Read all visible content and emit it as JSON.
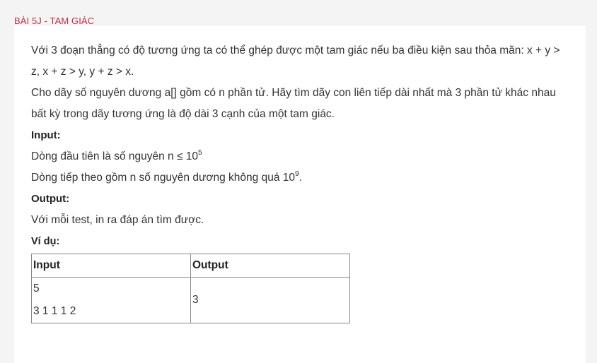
{
  "header": {
    "title": "BÀI 5J - TAM GIÁC"
  },
  "problem": {
    "paragraph1": "Với 3 đoạn thẳng có độ tương ứng ta có thể ghép được một tam giác nếu ba điều kiện sau thỏa mãn: x + y > z, x + z > y, y + z > x.",
    "paragraph2": "Cho dãy số nguyên dương a[] gồm có n phần tử. Hãy tìm dãy con liên tiếp dài nhất mà 3 phần tử khác nhau bất kỳ trong dãy tương ứng là độ dài 3 cạnh của một tam giác.",
    "input_heading": "Input:",
    "input_line1_text": "Dòng đầu tiên là số nguyên n ≤ 10",
    "input_line1_exp": "5",
    "input_line2_text": "Dòng tiếp theo gồm n số nguyên dương không quá 10",
    "input_line2_exp": "9",
    "input_line2_suffix": ".",
    "output_heading": "Output:",
    "output_text": "Với mỗi test, in ra đáp án tìm được.",
    "example_heading": "Ví dụ:"
  },
  "example_table": {
    "headers": [
      "Input",
      "Output"
    ],
    "input_lines": [
      "5",
      "3 1 1 1 2"
    ],
    "output_value": "3"
  }
}
